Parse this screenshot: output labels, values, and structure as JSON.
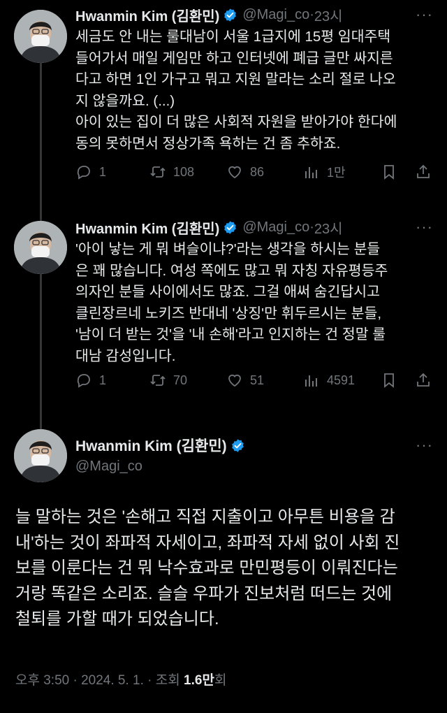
{
  "author": {
    "name": "Hwanmin Kim (김환민)",
    "handle": "@Magi_co"
  },
  "tweets": [
    {
      "time": "23시",
      "text": "세금도 안 내는 룰대남이 서울 1급지에 15평 임대주택\n들어가서 매일 게임만 하고 인터넷에 폐급 글만 싸지른\n다고 하면 1인 가구고 뭐고 지원 말라는 소리 절로 나오\n지 않을까요. (...)\n아이 있는 집이 더 많은 사회적 자원을 받아가야 한다에\n동의 못하면서 정상가족 욕하는 건 좀 추하죠.",
      "replies": "1",
      "retweets": "108",
      "likes": "86",
      "views": "1만"
    },
    {
      "time": "23시",
      "text": "'아이 낳는 게 뭐 벼슬이냐?'라는 생각을 하시는 분들\n은 꽤 많습니다. 여성 쪽에도 많고 뭐 자칭 자유평등주\n의자인 분들 사이에서도 많죠. 그걸 애써 숨긴답시고\n클린장르네 노키즈 반대네 '상징'만 휘두르시는 분들,\n'남이 더 받는 것'을 '내 손해'라고 인지하는 건 정말 룰\n대남 감성입니다.",
      "replies": "1",
      "retweets": "70",
      "likes": "51",
      "views": "4591"
    }
  ],
  "main_tweet": {
    "text": "늘 말하는 것은 '손해고 직접 지출이고 아무튼 비용을 감\n내'하는 것이 좌파적 자세이고, 좌파적 자세 없이 사회 진\n보를 이룬다는 건 뭐 낙수효과로 만민평등이 이뤄진다는\n거랑 똑같은 소리죠. 슬슬 우파가 진보처럼 떠드는 것에\n철퇴를 가할 때가 되었습니다.",
    "timestamp": "오후 3:50 · 2024. 5. 1. · 조회 ",
    "views": "1.6만",
    "views_suffix": "회"
  },
  "ui": {
    "separator_dot": "·",
    "more_glyph": "···"
  },
  "colors": {
    "background": "#000000",
    "text": "#e7e9ea",
    "muted": "#71767b",
    "verified": "#1d9bf0"
  },
  "icons": [
    "verified-badge-icon",
    "reply-icon",
    "retweet-icon",
    "like-icon",
    "views-icon",
    "bookmark-icon",
    "share-icon",
    "more-icon"
  ]
}
